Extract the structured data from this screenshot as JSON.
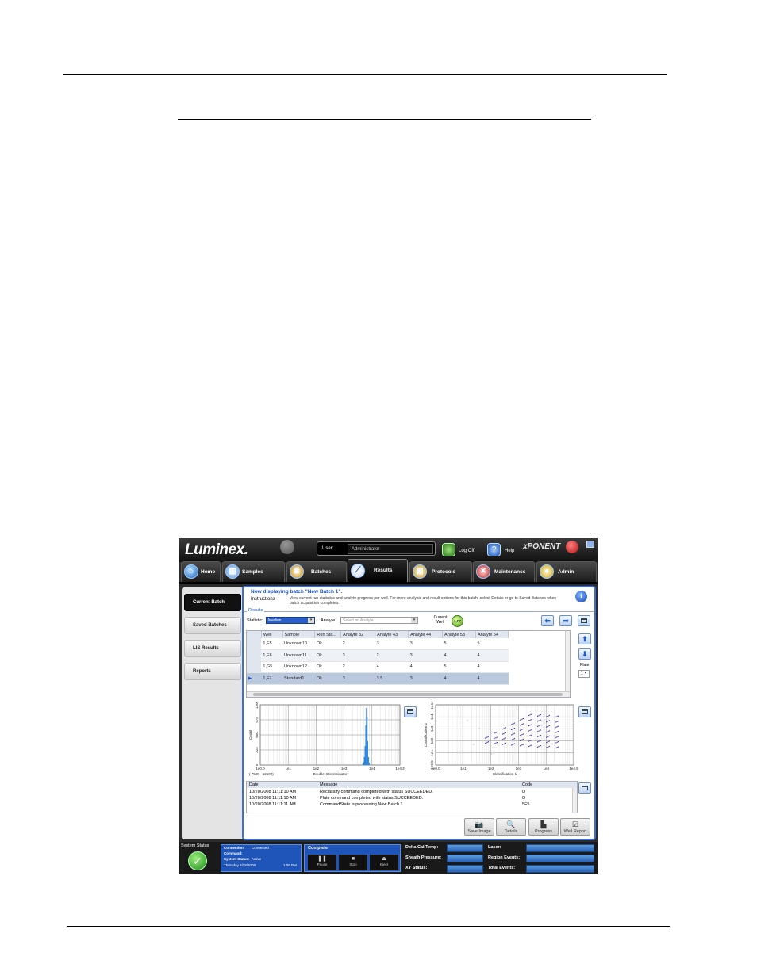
{
  "app": {
    "logo": "Luminex.",
    "brand_logo": "xPONENT",
    "user_label": "User:",
    "user_value": "Administrator",
    "logoff_label": "Log Off",
    "help_label": "Help"
  },
  "nav": [
    {
      "label": "Home",
      "icon": "home-icon"
    },
    {
      "label": "Samples",
      "icon": "samples-icon"
    },
    {
      "label": "Batches",
      "icon": "batches-icon"
    },
    {
      "label": "Results",
      "icon": "results-icon",
      "active": true
    },
    {
      "label": "Protocols",
      "icon": "protocols-icon"
    },
    {
      "label": "Maintenance",
      "icon": "maintenance-icon"
    },
    {
      "label": "Admin",
      "icon": "admin-icon"
    }
  ],
  "sidebar": [
    {
      "label": "Current Batch",
      "active": true
    },
    {
      "label": "Saved Batches"
    },
    {
      "label": "LIS Results"
    },
    {
      "label": "Reports"
    }
  ],
  "header": {
    "title": "Now displaying batch \"New Batch 1\".",
    "instructions_label": "Instructions",
    "instructions_text": "View current run statistics and analyte progress per well. For more analysis and result options for this batch, select Details or go to Saved Batches when batch acquisition completes."
  },
  "results": {
    "group_label": "Results",
    "statistic_label": "Statistic:",
    "statistic_value": "Median",
    "analyte_label": "Analyte",
    "analyte_placeholder": "Select an Analyte",
    "current_well_label": "Current Well",
    "current_well_value": "1,F7",
    "plate_label": "Plate",
    "plate_value": "1",
    "columns": [
      "",
      "Well",
      "Sample",
      "Run Sta...",
      "Analyte 32",
      "Analyte 43",
      "Analyte 44",
      "Analyte 53",
      "Analyte 54"
    ],
    "rows": [
      {
        "marker": "",
        "well": "1,E5",
        "sample": "Unknown10",
        "status": "Ok",
        "a32": "2",
        "a43": "3",
        "a44": "3",
        "a53": "5",
        "a54": "5"
      },
      {
        "marker": "",
        "well": "1,E6",
        "sample": "Unknown11",
        "status": "Ok",
        "a32": "3",
        "a43": "2",
        "a44": "3",
        "a53": "4",
        "a54": "4"
      },
      {
        "marker": "",
        "well": "1,G5",
        "sample": "Unknown12",
        "status": "Ok",
        "a32": "2",
        "a43": "4",
        "a44": "4",
        "a53": "5",
        "a54": "4"
      },
      {
        "marker": "▶",
        "well": "1,F7",
        "sample": "Standard1",
        "status": "Ok",
        "a32": "3",
        "a43": "3.5",
        "a44": "3",
        "a53": "4",
        "a54": "4"
      }
    ]
  },
  "histogram": {
    "ylabel": "Count",
    "xlabel": "Doublet Discriminator",
    "gate": "( 7500 - 12500)",
    "xticks": [
      "1e0.0",
      "1e1",
      "1e2",
      "1e3",
      "1e4",
      "1e4.3"
    ],
    "yticks": [
      "0",
      "325",
      "650",
      "975",
      "1300"
    ]
  },
  "scatter": {
    "ylabel": "Classification 2",
    "xlabel": "Classification 1",
    "xticks": [
      "1e0.0",
      "1e1",
      "1e2",
      "1e3",
      "1e4",
      "1e4.5"
    ],
    "yticks": [
      "1e0.0",
      "1e1",
      "1e2",
      "1e3",
      "1e4",
      "1e4.5"
    ]
  },
  "log": {
    "columns": [
      "Date",
      "Message",
      "Code"
    ],
    "rows": [
      {
        "date": "10/20/2008 11:11:10 AM",
        "message": "Reclassify command completed with status SUCCEEDED.",
        "code": "0"
      },
      {
        "date": "10/20/2008 11:11:10 AM",
        "message": "Plate command completed with status SUCCEEDED.",
        "code": "0"
      },
      {
        "date": "10/20/2008 11:11:11 AM",
        "message": "CommandState is processing New Batch 1",
        "code": "5F5"
      }
    ]
  },
  "actions": [
    "Save Image",
    "Details",
    "Progress",
    "Well Report"
  ],
  "status": {
    "title": "System Status",
    "connection_label": "Connection:",
    "connection_value": "Connected",
    "command_label": "Command:",
    "system_status_label": "System Status:",
    "system_status_value": "Active",
    "date": "Thursday 8/28/2008",
    "time": "1:05 PM",
    "progress_label": "Complete",
    "controls": [
      "Pause",
      "Stop",
      "Eject"
    ],
    "fields_left": [
      "Delta Cal Temp:",
      "Sheath Pressure:",
      "XY Status:"
    ],
    "fields_right": [
      "Laser:",
      "Region Events:",
      "Total Events:"
    ]
  },
  "colors": {
    "accent": "#3b6fd6",
    "histogram_fill": "#1e7fe0",
    "scatter_points": "#4b2fb0"
  }
}
